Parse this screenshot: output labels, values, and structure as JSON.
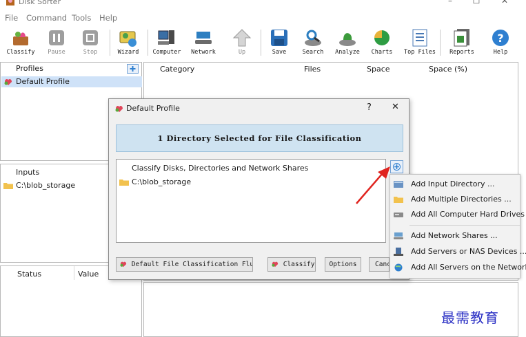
{
  "window": {
    "title": "Disk Sorter"
  },
  "menu": [
    "File",
    "Command",
    "Tools",
    "Help"
  ],
  "toolbar": [
    {
      "label": "Classify",
      "icon": "classify-icon",
      "enabled": true
    },
    {
      "label": "Pause",
      "icon": "pause-icon",
      "enabled": false
    },
    {
      "label": "Stop",
      "icon": "stop-icon",
      "enabled": false
    },
    {
      "label": "Wizard",
      "icon": "wizard-icon",
      "enabled": true
    },
    {
      "label": "Computer",
      "icon": "computer-icon",
      "enabled": true
    },
    {
      "label": "Network",
      "icon": "network-icon",
      "enabled": true
    },
    {
      "label": "Up",
      "icon": "up-arrow-icon",
      "enabled": false
    },
    {
      "label": "Save",
      "icon": "save-icon",
      "enabled": true
    },
    {
      "label": "Search",
      "icon": "search-icon",
      "enabled": true
    },
    {
      "label": "Analyze",
      "icon": "analyze-icon",
      "enabled": true
    },
    {
      "label": "Charts",
      "icon": "charts-icon",
      "enabled": true
    },
    {
      "label": "Top Files",
      "icon": "top-files-icon",
      "enabled": true
    },
    {
      "label": "Reports",
      "icon": "reports-icon",
      "enabled": true
    },
    {
      "label": "Help",
      "icon": "help-icon",
      "enabled": true
    }
  ],
  "profiles": {
    "header": "Profiles",
    "items": [
      "Default Profile"
    ]
  },
  "inputs": {
    "header": "Inputs",
    "items": [
      "C:\\blob_storage"
    ]
  },
  "status": {
    "col_status": "Status",
    "col_value": "Value"
  },
  "results": {
    "columns": [
      "Category",
      "Files",
      "Space",
      "Space (%)"
    ]
  },
  "dialog": {
    "title": "Default Profile",
    "help_glyph": "?",
    "close_glyph": "✕",
    "banner": "1 Directory Selected for File Classification",
    "list_header": "Classify Disks, Directories and Network Shares",
    "list_items": [
      "C:\\blob_storage"
    ],
    "rules_dropdown": "Default File Classification Flu",
    "classify_button": "Classify",
    "options_button": "Options",
    "cancel_button": "Canc"
  },
  "popup_menu": [
    {
      "label": "Add Input Directory ...",
      "icon": "input-directory-icon"
    },
    {
      "label": "Add Multiple Directories ...",
      "icon": "folder-icon"
    },
    {
      "label": "Add All Computer Hard Drives",
      "icon": "hard-drive-icon"
    },
    {
      "label": "Add Network Shares ...",
      "icon": "network-share-icon"
    },
    {
      "label": "Add Servers or NAS Devices ...",
      "icon": "server-icon"
    },
    {
      "label": "Add All Servers on the Network",
      "icon": "network-globe-icon"
    }
  ],
  "watermark": "最需教育",
  "colors": {
    "selection": "#cfe2f8",
    "banner": "#cfe3f1",
    "annotation_arrow": "#e0241f"
  }
}
